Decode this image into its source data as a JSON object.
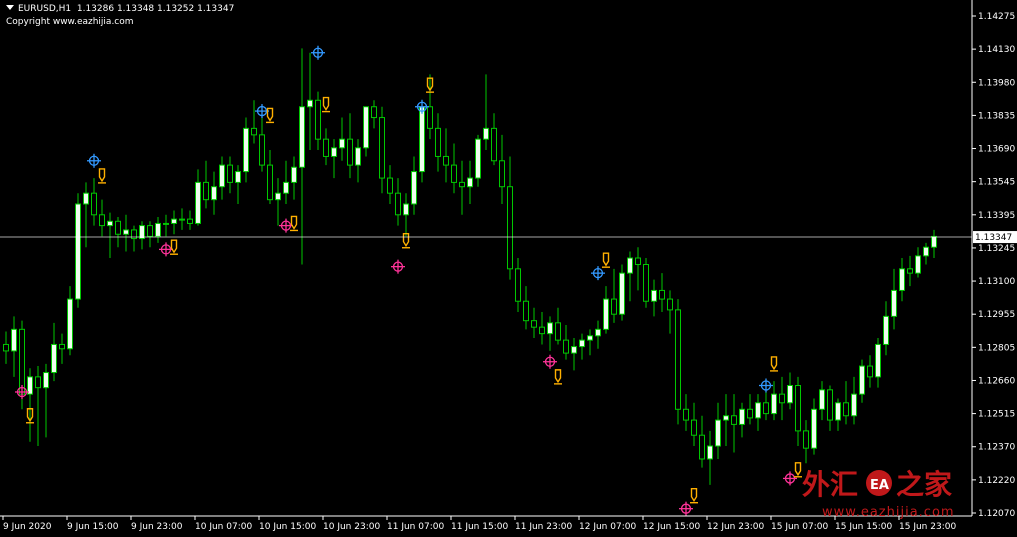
{
  "header": {
    "symbol": "EURUSD,H1",
    "ohlc": "1.13286 1.13348 1.13252 1.13347",
    "copyright": "Copyright www.eazhijia.com"
  },
  "watermark": {
    "cn_text": "外汇之家",
    "badge": "EA",
    "url": "www.eazhijia.com"
  },
  "colors": {
    "background": "#000000",
    "bull_body": "#f0fff0",
    "bear_body": "#000000",
    "candle_outline": "#00c800",
    "axis": "#ffffff",
    "price_line": "#ffffff",
    "buy_marker": "#ffb000",
    "sell_marker": "#3399ff",
    "stop_marker": "#ff3399",
    "label_bg": "#ffffff",
    "label_text": "#000000"
  },
  "chart_data": {
    "type": "candlestick",
    "symbol": "EURUSD",
    "timeframe": "H1",
    "current_price": 1.13347,
    "current_price_label": "1.13347",
    "ylim": [
      1.1207,
      1.1437
    ],
    "y_ticks": [
      "1.14275",
      "1.14130",
      "1.13980",
      "1.13835",
      "1.13690",
      "1.13545",
      "1.13395",
      "1.13245",
      "1.13100",
      "1.12955",
      "1.12805",
      "1.12660",
      "1.12515",
      "1.12370",
      "1.12220",
      "1.12070"
    ],
    "x_ticks": [
      {
        "index": 0,
        "label": "9 Jun 2020"
      },
      {
        "index": 8,
        "label": "9 Jun 15:00"
      },
      {
        "index": 16,
        "label": "9 Jun 23:00"
      },
      {
        "index": 24,
        "label": "10 Jun 07:00"
      },
      {
        "index": 32,
        "label": "10 Jun 15:00"
      },
      {
        "index": 40,
        "label": "10 Jun 23:00"
      },
      {
        "index": 48,
        "label": "11 Jun 07:00"
      },
      {
        "index": 56,
        "label": "11 Jun 15:00"
      },
      {
        "index": 64,
        "label": "11 Jun 23:00"
      },
      {
        "index": 72,
        "label": "12 Jun 07:00"
      },
      {
        "index": 80,
        "label": "12 Jun 15:00"
      },
      {
        "index": 88,
        "label": "12 Jun 23:00"
      },
      {
        "index": 96,
        "label": "15 Jun 07:00"
      },
      {
        "index": 104,
        "label": "15 Jun 15:00"
      },
      {
        "index": 112,
        "label": "15 Jun 23:00"
      }
    ],
    "candles": [
      [
        1.1285,
        1.1291,
        1.1276,
        1.1282
      ],
      [
        1.1282,
        1.1298,
        1.127,
        1.1292
      ],
      [
        1.1292,
        1.1296,
        1.1255,
        1.1262
      ],
      [
        1.1262,
        1.1274,
        1.124,
        1.127
      ],
      [
        1.127,
        1.1275,
        1.1238,
        1.1265
      ],
      [
        1.1265,
        1.1276,
        1.1242,
        1.1272
      ],
      [
        1.1272,
        1.1295,
        1.1268,
        1.1285
      ],
      [
        1.1285,
        1.129,
        1.1276,
        1.1283
      ],
      [
        1.1283,
        1.1312,
        1.128,
        1.1306
      ],
      [
        1.1306,
        1.1355,
        1.1302,
        1.135
      ],
      [
        1.135,
        1.136,
        1.133,
        1.1355
      ],
      [
        1.1355,
        1.1362,
        1.134,
        1.1345
      ],
      [
        1.1345,
        1.1352,
        1.1335,
        1.134
      ],
      [
        1.134,
        1.1346,
        1.1325,
        1.1342
      ],
      [
        1.1342,
        1.1344,
        1.133,
        1.1336
      ],
      [
        1.1336,
        1.1345,
        1.1328,
        1.1338
      ],
      [
        1.1338,
        1.134,
        1.1328,
        1.1334
      ],
      [
        1.1334,
        1.1342,
        1.1329,
        1.134
      ],
      [
        1.134,
        1.1342,
        1.133,
        1.1335
      ],
      [
        1.1335,
        1.1344,
        1.1332,
        1.1341
      ],
      [
        1.1341,
        1.1345,
        1.1335,
        1.1341
      ],
      [
        1.1341,
        1.1347,
        1.1336,
        1.1343
      ],
      [
        1.1343,
        1.1348,
        1.1338,
        1.1343
      ],
      [
        1.1343,
        1.1347,
        1.1338,
        1.1341
      ],
      [
        1.1341,
        1.1366,
        1.134,
        1.136
      ],
      [
        1.136,
        1.137,
        1.1348,
        1.1352
      ],
      [
        1.1352,
        1.1365,
        1.1345,
        1.1358
      ],
      [
        1.1358,
        1.1372,
        1.1352,
        1.1368
      ],
      [
        1.1368,
        1.1372,
        1.1355,
        1.136
      ],
      [
        1.136,
        1.1368,
        1.135,
        1.1365
      ],
      [
        1.1365,
        1.139,
        1.136,
        1.1385
      ],
      [
        1.1385,
        1.1398,
        1.1378,
        1.1382
      ],
      [
        1.1382,
        1.1395,
        1.1365,
        1.1368
      ],
      [
        1.1368,
        1.1375,
        1.135,
        1.1352
      ],
      [
        1.1352,
        1.1362,
        1.134,
        1.1355
      ],
      [
        1.1355,
        1.137,
        1.135,
        1.136
      ],
      [
        1.136,
        1.1372,
        1.1352,
        1.1367
      ],
      [
        1.1367,
        1.1422,
        1.1322,
        1.1395
      ],
      [
        1.1395,
        1.142,
        1.1375,
        1.1398
      ],
      [
        1.1398,
        1.1402,
        1.1375,
        1.138
      ],
      [
        1.138,
        1.1385,
        1.1368,
        1.1372
      ],
      [
        1.1372,
        1.138,
        1.1362,
        1.1376
      ],
      [
        1.1376,
        1.139,
        1.137,
        1.138
      ],
      [
        1.138,
        1.1392,
        1.1362,
        1.1368
      ],
      [
        1.1368,
        1.138,
        1.136,
        1.1376
      ],
      [
        1.1376,
        1.1388,
        1.1372,
        1.1395
      ],
      [
        1.1395,
        1.1398,
        1.1385,
        1.139
      ],
      [
        1.139,
        1.1395,
        1.1355,
        1.1362
      ],
      [
        1.1362,
        1.1368,
        1.135,
        1.1355
      ],
      [
        1.1355,
        1.1362,
        1.134,
        1.1345
      ],
      [
        1.1345,
        1.1355,
        1.1335,
        1.135
      ],
      [
        1.135,
        1.1372,
        1.1345,
        1.1365
      ],
      [
        1.1365,
        1.1385,
        1.136,
        1.1395
      ],
      [
        1.1395,
        1.141,
        1.138,
        1.1385
      ],
      [
        1.1385,
        1.1392,
        1.1365,
        1.1372
      ],
      [
        1.1372,
        1.1385,
        1.136,
        1.1368
      ],
      [
        1.1368,
        1.1378,
        1.1355,
        1.136
      ],
      [
        1.136,
        1.137,
        1.1345,
        1.1358
      ],
      [
        1.1358,
        1.137,
        1.135,
        1.1362
      ],
      [
        1.1362,
        1.1382,
        1.1358,
        1.138
      ],
      [
        1.138,
        1.141,
        1.1375,
        1.1385
      ],
      [
        1.1385,
        1.1392,
        1.1368,
        1.137
      ],
      [
        1.137,
        1.1382,
        1.135,
        1.1358
      ],
      [
        1.1358,
        1.1372,
        1.1315,
        1.132
      ],
      [
        1.132,
        1.1325,
        1.13,
        1.1305
      ],
      [
        1.1305,
        1.1312,
        1.1292,
        1.1296
      ],
      [
        1.1296,
        1.1302,
        1.1288,
        1.1293
      ],
      [
        1.1293,
        1.13,
        1.1285,
        1.129
      ],
      [
        1.129,
        1.1298,
        1.1282,
        1.1295
      ],
      [
        1.1295,
        1.1302,
        1.1285,
        1.1287
      ],
      [
        1.1287,
        1.1294,
        1.1278,
        1.1281
      ],
      [
        1.1281,
        1.1288,
        1.1273,
        1.1284
      ],
      [
        1.1284,
        1.129,
        1.1278,
        1.1287
      ],
      [
        1.1287,
        1.1292,
        1.128,
        1.1289
      ],
      [
        1.1289,
        1.1296,
        1.1283,
        1.1292
      ],
      [
        1.1292,
        1.1312,
        1.129,
        1.1306
      ],
      [
        1.1306,
        1.132,
        1.1295,
        1.1299
      ],
      [
        1.1299,
        1.1322,
        1.1296,
        1.1318
      ],
      [
        1.1318,
        1.1328,
        1.1305,
        1.1325
      ],
      [
        1.1325,
        1.133,
        1.131,
        1.1322
      ],
      [
        1.1322,
        1.1325,
        1.1302,
        1.1305
      ],
      [
        1.1305,
        1.1315,
        1.1298,
        1.131
      ],
      [
        1.131,
        1.1318,
        1.13,
        1.1306
      ],
      [
        1.1306,
        1.131,
        1.129,
        1.1301
      ],
      [
        1.1301,
        1.1306,
        1.1248,
        1.1255
      ],
      [
        1.1255,
        1.1262,
        1.1245,
        1.125
      ],
      [
        1.125,
        1.1258,
        1.1238,
        1.1243
      ],
      [
        1.1243,
        1.1252,
        1.1228,
        1.1232
      ],
      [
        1.1232,
        1.1245,
        1.122,
        1.1238
      ],
      [
        1.1238,
        1.1258,
        1.1232,
        1.125
      ],
      [
        1.125,
        1.1262,
        1.1238,
        1.1252
      ],
      [
        1.1252,
        1.1262,
        1.1235,
        1.1248
      ],
      [
        1.1248,
        1.1258,
        1.1242,
        1.1255
      ],
      [
        1.1255,
        1.1262,
        1.1248,
        1.1251
      ],
      [
        1.1251,
        1.1262,
        1.1245,
        1.1258
      ],
      [
        1.1258,
        1.1265,
        1.125,
        1.1253
      ],
      [
        1.1253,
        1.1268,
        1.125,
        1.1262
      ],
      [
        1.1262,
        1.127,
        1.125,
        1.1258
      ],
      [
        1.1258,
        1.1272,
        1.1255,
        1.1266
      ],
      [
        1.1266,
        1.127,
        1.1238,
        1.1245
      ],
      [
        1.1245,
        1.125,
        1.123,
        1.1237
      ],
      [
        1.1237,
        1.126,
        1.1234,
        1.1255
      ],
      [
        1.1255,
        1.1268,
        1.125,
        1.1264
      ],
      [
        1.1264,
        1.1266,
        1.1245,
        1.125
      ],
      [
        1.125,
        1.126,
        1.1245,
        1.1258
      ],
      [
        1.1258,
        1.1268,
        1.1248,
        1.1252
      ],
      [
        1.1252,
        1.127,
        1.1248,
        1.1262
      ],
      [
        1.1262,
        1.1278,
        1.1258,
        1.1275
      ],
      [
        1.1275,
        1.128,
        1.1265,
        1.127
      ],
      [
        1.127,
        1.1288,
        1.1265,
        1.1285
      ],
      [
        1.1285,
        1.1305,
        1.128,
        1.1298
      ],
      [
        1.1298,
        1.132,
        1.1292,
        1.131
      ],
      [
        1.131,
        1.1325,
        1.1305,
        1.132
      ],
      [
        1.132,
        1.1326,
        1.1312,
        1.1318
      ],
      [
        1.1318,
        1.133,
        1.1316,
        1.1326
      ],
      [
        1.1326,
        1.1332,
        1.1322,
        1.133
      ],
      [
        1.133,
        1.1338,
        1.1325,
        1.1335
      ]
    ],
    "markers": [
      {
        "type": "stop",
        "index": 2,
        "price": 1.1263
      },
      {
        "type": "buy",
        "index": 3,
        "price": 1.1252
      },
      {
        "type": "sell",
        "index": 11,
        "price": 1.137
      },
      {
        "type": "buy",
        "index": 12,
        "price": 1.1363
      },
      {
        "type": "stop",
        "index": 20,
        "price": 1.1329
      },
      {
        "type": "buy",
        "index": 21,
        "price": 1.133
      },
      {
        "type": "sell",
        "index": 32,
        "price": 1.1393
      },
      {
        "type": "buy",
        "index": 33,
        "price": 1.1391
      },
      {
        "type": "stop",
        "index": 35,
        "price": 1.134
      },
      {
        "type": "buy",
        "index": 36,
        "price": 1.1341
      },
      {
        "type": "sell",
        "index": 39,
        "price": 1.142
      },
      {
        "type": "buy",
        "index": 40,
        "price": 1.1396
      },
      {
        "type": "stop",
        "index": 49,
        "price": 1.1321
      },
      {
        "type": "buy",
        "index": 50,
        "price": 1.1333
      },
      {
        "type": "sell",
        "index": 52,
        "price": 1.1395
      },
      {
        "type": "buy",
        "index": 53,
        "price": 1.1405
      },
      {
        "type": "stop",
        "index": 68,
        "price": 1.1277
      },
      {
        "type": "buy",
        "index": 69,
        "price": 1.127
      },
      {
        "type": "sell",
        "index": 74,
        "price": 1.1318
      },
      {
        "type": "buy",
        "index": 75,
        "price": 1.1324
      },
      {
        "type": "stop",
        "index": 85,
        "price": 1.1209
      },
      {
        "type": "buy",
        "index": 86,
        "price": 1.1215
      },
      {
        "type": "sell",
        "index": 95,
        "price": 1.1266
      },
      {
        "type": "buy",
        "index": 96,
        "price": 1.1276
      },
      {
        "type": "stop",
        "index": 98,
        "price": 1.1223
      },
      {
        "type": "buy",
        "index": 99,
        "price": 1.1227
      }
    ]
  }
}
